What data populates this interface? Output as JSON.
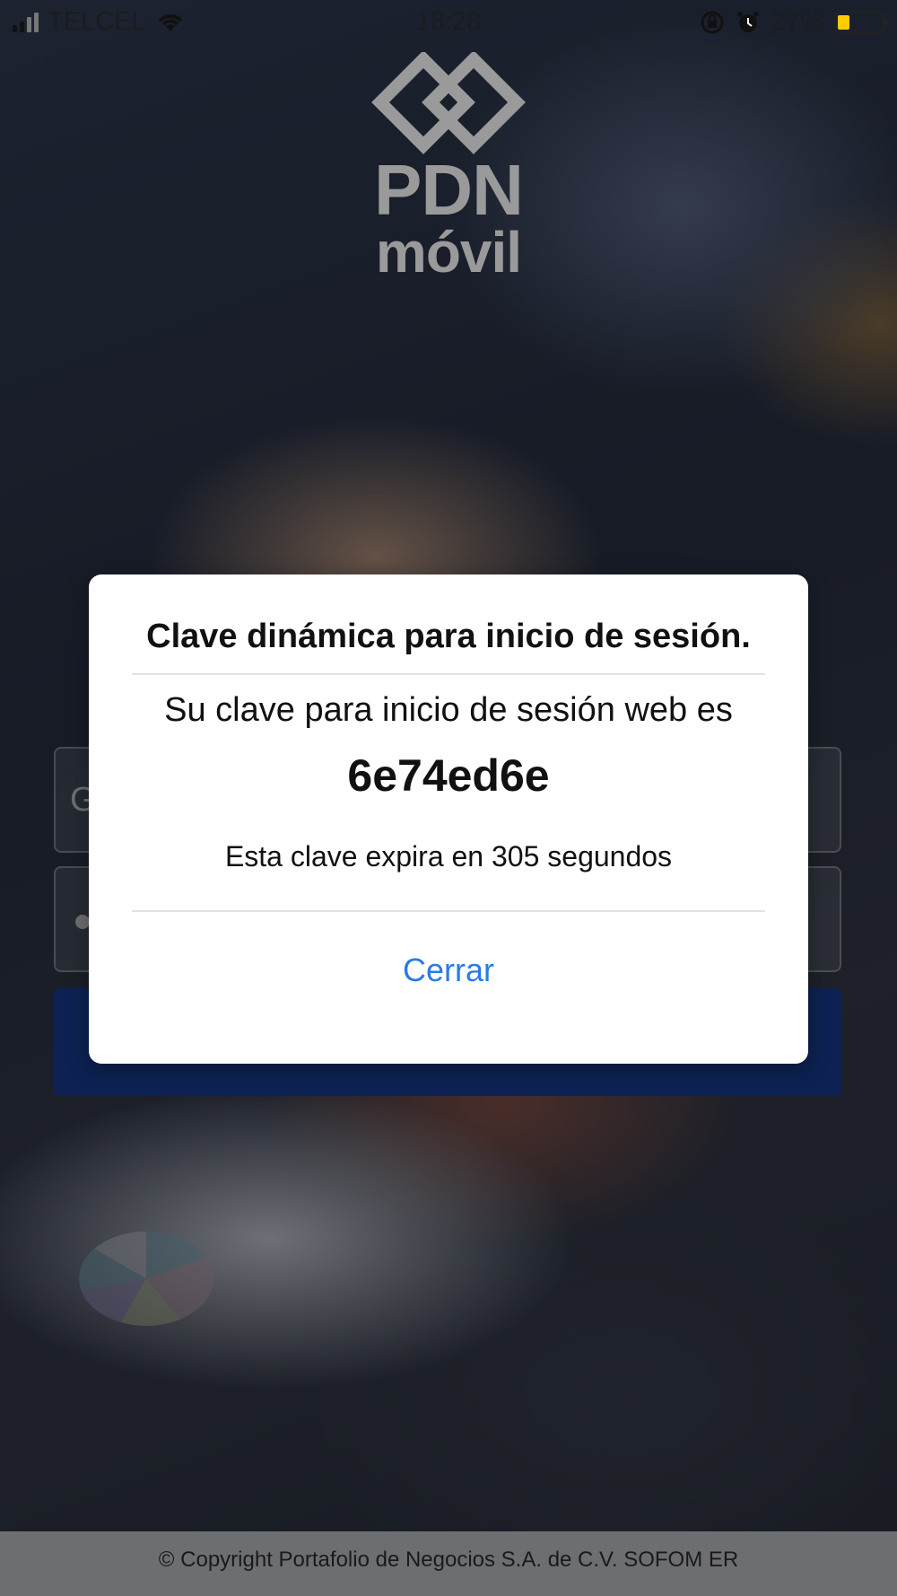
{
  "status_bar": {
    "carrier": "TELCEL",
    "time": "18:28",
    "battery_percent": "27%",
    "battery_level": 0.27,
    "battery_color": "#ffcc00",
    "icons": [
      "signal-icon",
      "wifi-icon",
      "orientation-lock-icon",
      "alarm-icon",
      "battery-icon"
    ]
  },
  "logo": {
    "line1": "PDN",
    "line2": "móvil"
  },
  "login_form": {
    "user_placeholder": "G"
  },
  "modal": {
    "title": "Clave dinámica para inicio de sesión.",
    "message": "Su clave para inicio de sesión web es",
    "code": "6e74ed6e",
    "expiry": "Esta clave expira en 305 segundos",
    "close_label": "Cerrar",
    "accent_color": "#2a7be4"
  },
  "footer": {
    "copyright": "© Copyright Portafolio de Negocios S.A. de C.V. SOFOM ER"
  },
  "colors": {
    "login_button": "#0d2252",
    "footer_bg": "#6d6e72"
  }
}
